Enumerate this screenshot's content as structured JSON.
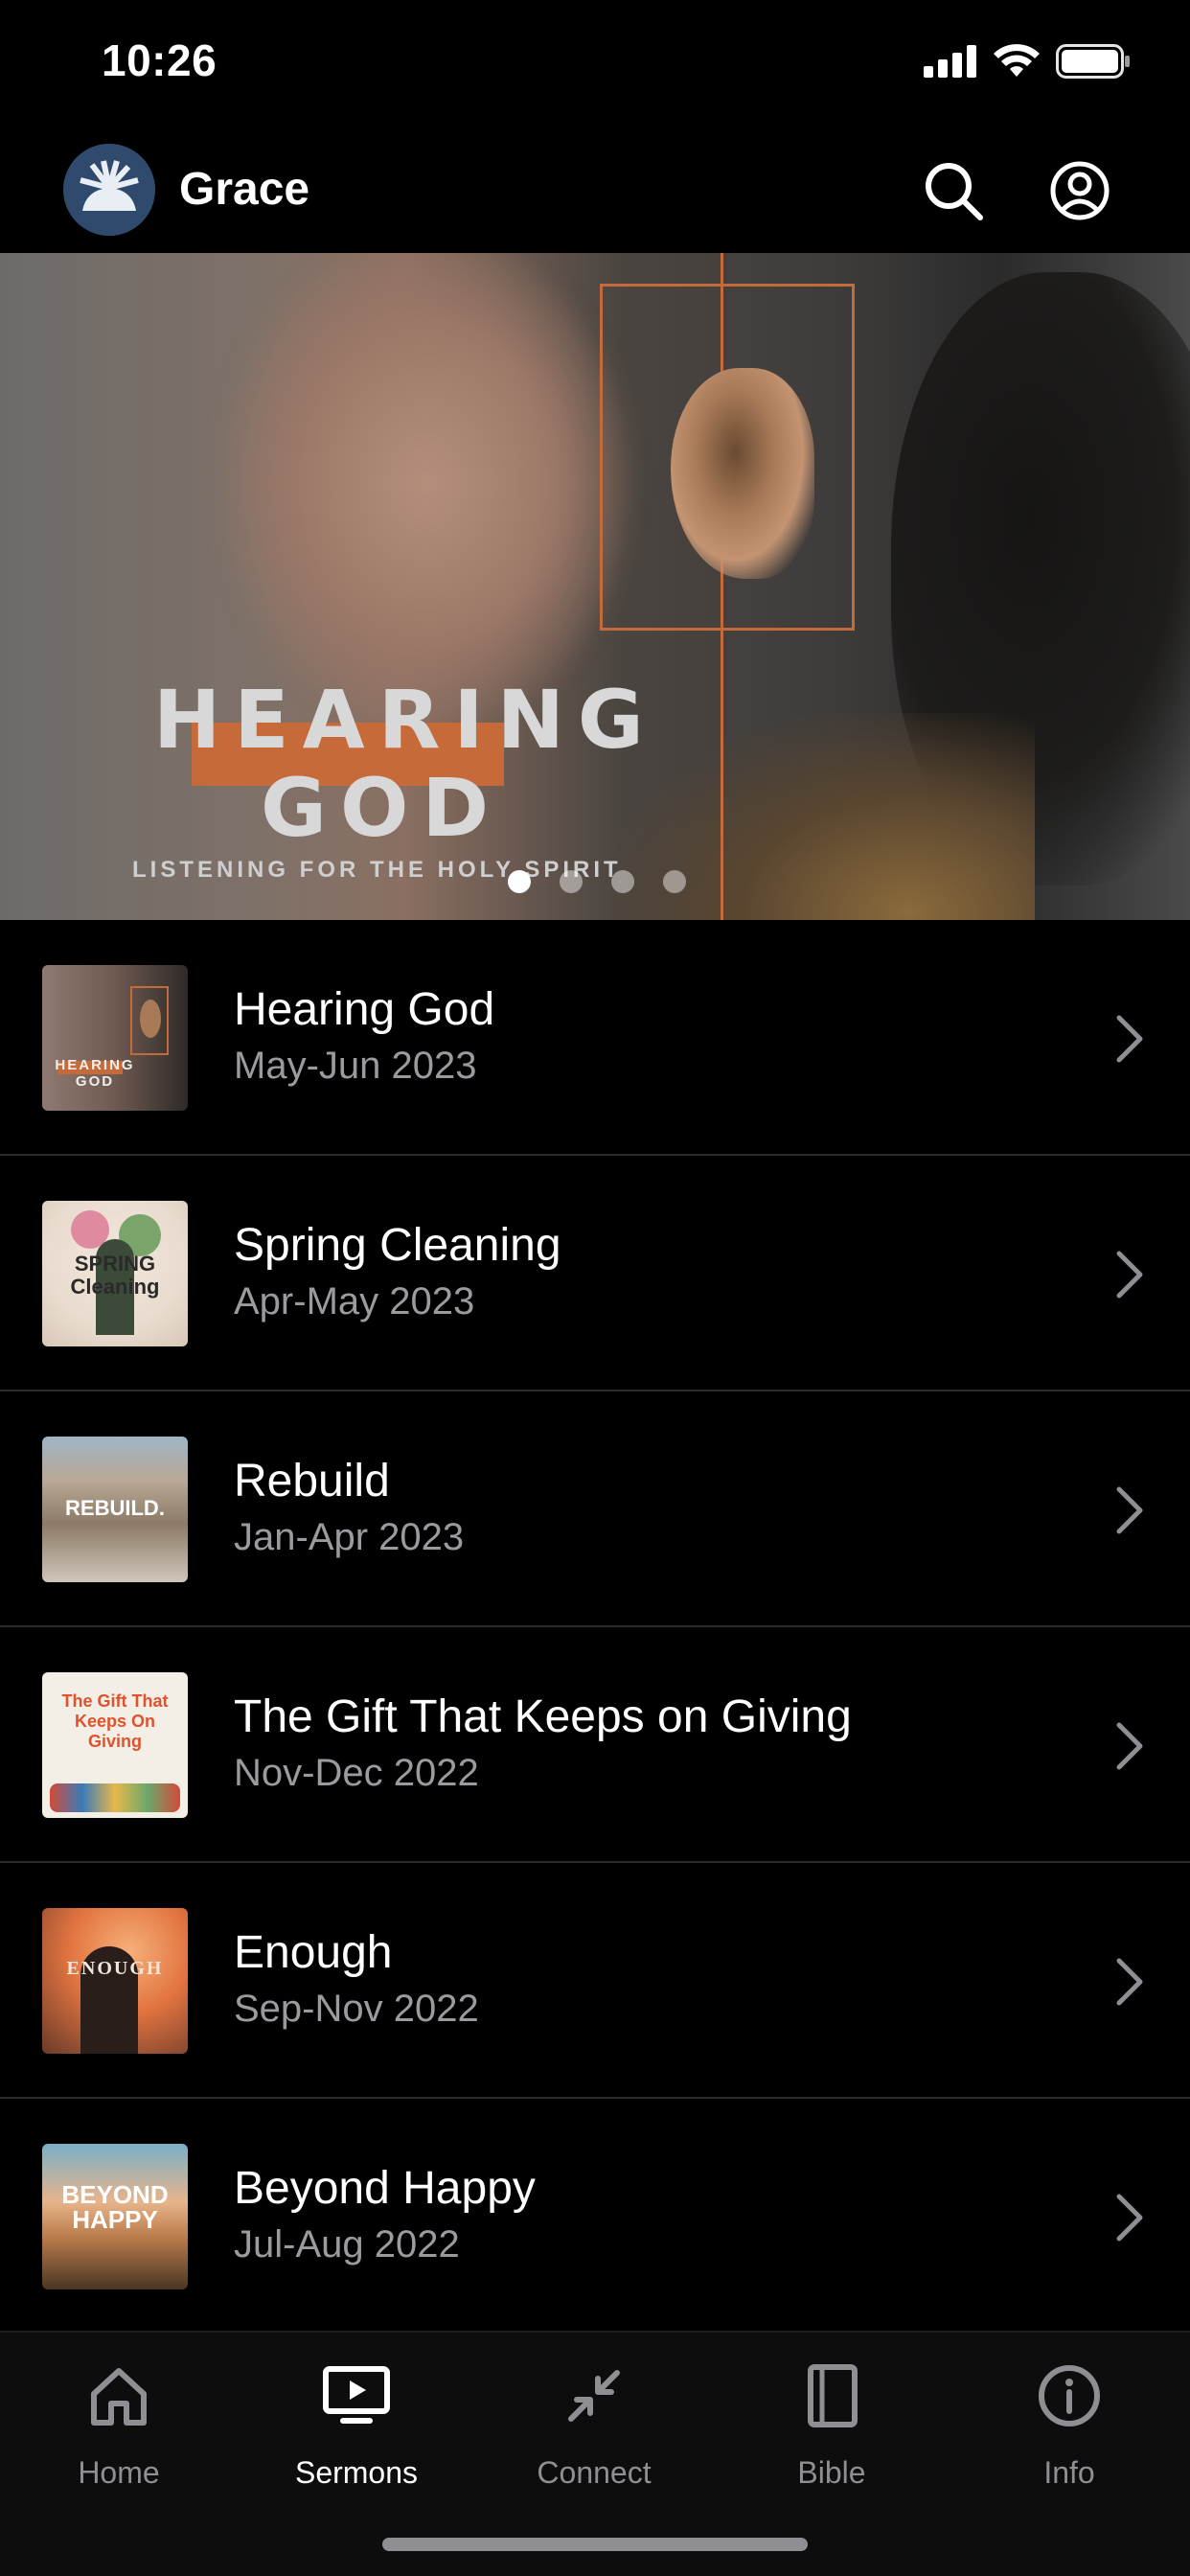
{
  "status_bar": {
    "time": "10:26"
  },
  "header": {
    "brand_name": "Grace"
  },
  "hero": {
    "title_line_1": "HEARING",
    "title_line_2": "GOD",
    "subtitle": "LISTENING FOR THE HOLY SPIRIT",
    "page_count": 4,
    "active_page": 1
  },
  "sermons": [
    {
      "title": "Hearing God",
      "dates": "May-Jun 2023",
      "thumb_text": "HEARING GOD"
    },
    {
      "title": "Spring Cleaning",
      "dates": "Apr-May 2023",
      "thumb_text": "SPRING Cleaning"
    },
    {
      "title": "Rebuild",
      "dates": "Jan-Apr 2023",
      "thumb_text": "REBUILD."
    },
    {
      "title": "The Gift That Keeps on Giving",
      "dates": "Nov-Dec 2022",
      "thumb_text": "The Gift That Keeps On Giving"
    },
    {
      "title": "Enough",
      "dates": "Sep-Nov 2022",
      "thumb_text": "ENOUGH"
    },
    {
      "title": "Beyond Happy",
      "dates": "Jul-Aug 2022",
      "thumb_text": "BEYOND HAPPY"
    }
  ],
  "tabs": [
    {
      "label": "Home",
      "icon": "home-icon"
    },
    {
      "label": "Sermons",
      "icon": "tv-play-icon",
      "active": true
    },
    {
      "label": "Connect",
      "icon": "connect-arrows-icon"
    },
    {
      "label": "Bible",
      "icon": "book-icon"
    },
    {
      "label": "Info",
      "icon": "info-icon"
    }
  ],
  "colors": {
    "accent_orange": "#c76a39",
    "background": "#000000",
    "secondary_text": "#9a9a9f",
    "brand_logo_bg": "#2f4a6d"
  }
}
